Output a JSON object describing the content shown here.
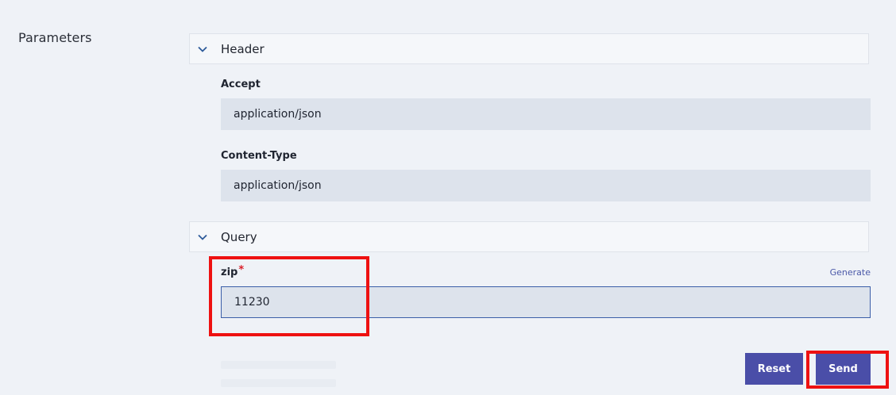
{
  "parameters_title": "Parameters",
  "sections": {
    "header": {
      "label": "Header",
      "icon": "chevron-down-icon"
    },
    "query": {
      "label": "Query",
      "icon": "chevron-down-icon"
    }
  },
  "fields": {
    "accept": {
      "label": "Accept",
      "value": "application/json"
    },
    "content_type": {
      "label": "Content-Type",
      "value": "application/json"
    },
    "zip": {
      "label": "zip",
      "required_marker": "*",
      "value": "11230",
      "generate_label": "Generate"
    }
  },
  "buttons": {
    "reset": "Reset",
    "send": "Send"
  },
  "colors": {
    "accent": "#4a4ea8",
    "highlight": "#ee1111",
    "required": "#da1e28",
    "input_bg": "#dde3ec",
    "page_bg": "#eff2f7"
  }
}
